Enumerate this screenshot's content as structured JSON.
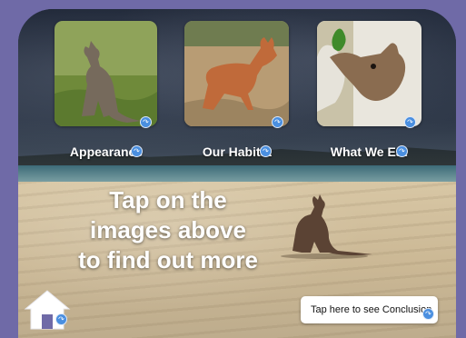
{
  "cards": [
    {
      "id": "appearance",
      "label": "Appearance",
      "image": "kangaroo-standing-on-grass",
      "icon": "link-arrow-icon"
    },
    {
      "id": "habitat",
      "label": "Our Habitat",
      "image": "kangaroo-in-dry-grassland",
      "icon": "link-arrow-icon"
    },
    {
      "id": "eat",
      "label": "What We Eat",
      "image": "joey-eating-leaves",
      "icon": "link-arrow-icon"
    }
  ],
  "instruction": {
    "line1": "Tap on the",
    "line2": "images above",
    "line3": "to find out more"
  },
  "conclusion_button": {
    "label": "Tap here to see Conclusion",
    "icon": "link-arrow-icon"
  },
  "home_button": {
    "icon": "home-icon",
    "badge_icon": "link-arrow-icon"
  },
  "colors": {
    "outer_background": "#6f6aa7",
    "link_badge": "#4a8fe0",
    "label_text": "#ffffff"
  }
}
